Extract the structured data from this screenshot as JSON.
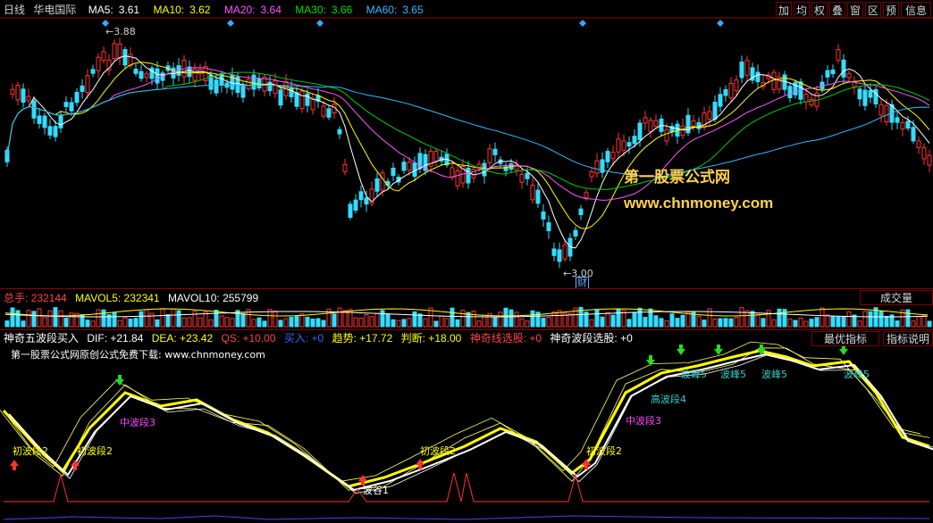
{
  "period": "日线",
  "stock_name": "华电国际",
  "ma": [
    {
      "label": "MA5:",
      "value": "3.61",
      "color": "#ffffff"
    },
    {
      "label": "MA10:",
      "value": "3.62",
      "color": "#ffff00"
    },
    {
      "label": "MA20:",
      "value": "3.64",
      "color": "#ff55ff"
    },
    {
      "label": "MA30:",
      "value": "3.66",
      "color": "#00dd00"
    },
    {
      "label": "MA60:",
      "value": "3.65",
      "color": "#33bbff"
    }
  ],
  "toolbar": [
    "加",
    "均",
    "权",
    "叠",
    "窗",
    "区",
    "预",
    "信息"
  ],
  "price_high_label": "3.88",
  "price_low_label": "3.00",
  "cai_label": "财",
  "watermark_cn": "第一股票公式网",
  "watermark_url": "www.chnmoney.com",
  "volume": {
    "label": "总手:",
    "value": "232144",
    "mavol5": "MAVOL5: 232341",
    "mavol10": "MAVOL10: 255799",
    "button": "成交量"
  },
  "indicator": {
    "name": "神奇五波段买入",
    "dif": "DIF: +21.84",
    "dea": "DEA: +23.42",
    "qs": "QS: +10.00",
    "buy": "买入: +0",
    "trend": "趋势: +17.72",
    "judge": "判断: +18.00",
    "sq_line": "神奇线选股: +0",
    "sq_band": "神奇波段选股: +0",
    "btn_best": "最优指标",
    "btn_explain": "指标说明",
    "subtitle": "第一股票公式网原创公式免费下载: www.chnmoney.com"
  },
  "wave_labels": [
    {
      "text": "初波段2",
      "color": "#ffff00"
    },
    {
      "text": "初波段2",
      "color": "#ffff00"
    },
    {
      "text": "中波段3",
      "color": "#ff44ff"
    },
    {
      "text": "初波段2",
      "color": "#ffff00"
    },
    {
      "text": "波谷1",
      "color": "#ffffff"
    },
    {
      "text": "初波段2",
      "color": "#ffff00"
    },
    {
      "text": "中波段3",
      "color": "#ff44ff"
    },
    {
      "text": "高波段4",
      "color": "#33cccc"
    },
    {
      "text": "波峰5",
      "color": "#33cccc"
    },
    {
      "text": "波峰5",
      "color": "#33cccc"
    },
    {
      "text": "波峰5",
      "color": "#33cccc"
    },
    {
      "text": "波峰5",
      "color": "#33cccc"
    }
  ]
}
